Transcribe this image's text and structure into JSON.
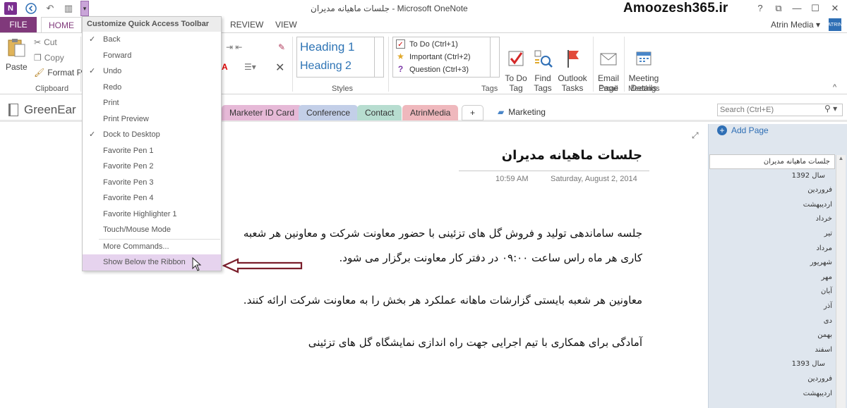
{
  "window": {
    "title": "جلسات ماهیانه مدیران - Microsoft OneNote",
    "watermark": "Amoozesh365.ir",
    "help": "?",
    "restore": "⧉",
    "minimize": "—",
    "maximize": "☐",
    "close": "✕"
  },
  "qat": {
    "logo": "N",
    "back": "⮌",
    "undo": "↶",
    "dock": "▥",
    "dropdown": "▾"
  },
  "tabs": {
    "file": "FILE",
    "home": "HOME",
    "review": "REVIEW",
    "view": "VIEW"
  },
  "user": {
    "name": "Atrin Media",
    "caret": "▾",
    "avatar": "ATRIN",
    "collapse": "^"
  },
  "ribbon": {
    "clipboard": {
      "paste": "Paste",
      "cut": "Cut",
      "copy": "Copy",
      "format_painter": "Format Pa",
      "label": "Clipboard"
    },
    "styles": {
      "heading1": "Heading 1",
      "heading2": "Heading 2",
      "label": "Styles"
    },
    "tags": {
      "todo": "To Do (Ctrl+1)",
      "important": "Important (Ctrl+2)",
      "question": "Question (Ctrl+3)",
      "todo_tag": "To Do\nTag",
      "find_tags": "Find\nTags",
      "outlook_tasks": "Outlook\nTasks",
      "label": "Tags"
    },
    "email": {
      "email_page": "Email\nPage",
      "label": "Email"
    },
    "meetings": {
      "meeting_details": "Meeting\nDetails",
      "label": "Meetings"
    }
  },
  "notebook": {
    "name": "GreenEar",
    "sections": [
      "Marketer ID Card",
      "Conference",
      "Contact",
      "AtrinMedia",
      "+"
    ],
    "section_colors": [
      "#e6b9d7",
      "#c3cfe8",
      "#b7ddd0",
      "#efb8bd",
      "#ffffff"
    ],
    "current_section": "Marketing",
    "search_placeholder": "Search (Ctrl+E)"
  },
  "page": {
    "title": "جلسات ماهیانه مدیران",
    "time": "10:59 AM",
    "date": "Saturday, August 2, 2014",
    "paragraphs": [
      "جلسه ساماندهی تولید و فروش گل های تزئینی با حضور معاونت شرکت و معاونین هر شعبه",
      "کاری هر ماه راس ساعت ۰۹:۰۰ در دفتر کار معاونت برگزار می شود.",
      "معاونین هر شعبه بایستی گزارشات ماهانه عملکرد هر بخش را به معاونت شرکت ارائه کنند.",
      "آمادگی برای همکاری با تیم اجرایی جهت راه اندازی نمایشگاه گل های تزئینی"
    ]
  },
  "page_list": {
    "add_page": "Add Page",
    "items": [
      "جلسات ماهیانه مدیران",
      "سال 1392",
      "فروردین",
      "اردیبهشت",
      "خرداد",
      "تیر",
      "مرداد",
      "شهریور",
      "مهر",
      "آبان",
      "آذر",
      "دی",
      "بهمن",
      "اسفند",
      "سال 1393",
      "فروردین",
      "اردیبهشت"
    ]
  },
  "qat_menu": {
    "header": "Customize Quick Access Toolbar",
    "items": [
      {
        "label": "Back",
        "checked": true
      },
      {
        "label": "Forward",
        "checked": false
      },
      {
        "label": "Undo",
        "checked": true
      },
      {
        "label": "Redo",
        "checked": false
      },
      {
        "label": "Print",
        "checked": false
      },
      {
        "label": "Print Preview",
        "checked": false
      },
      {
        "label": "Dock to Desktop",
        "checked": true
      },
      {
        "label": "Favorite Pen 1",
        "checked": false
      },
      {
        "label": "Favorite Pen 2",
        "checked": false
      },
      {
        "label": "Favorite Pen 3",
        "checked": false
      },
      {
        "label": "Favorite Pen 4",
        "checked": false
      },
      {
        "label": "Favorite Highlighter 1",
        "checked": false
      },
      {
        "label": "Touch/Mouse Mode",
        "checked": false
      }
    ],
    "more_commands": "More Commands...",
    "show_below": "Show Below the Ribbon",
    "check": "✓"
  },
  "colors": {
    "accent": "#80397b",
    "arrow": "#7b1f2c"
  }
}
